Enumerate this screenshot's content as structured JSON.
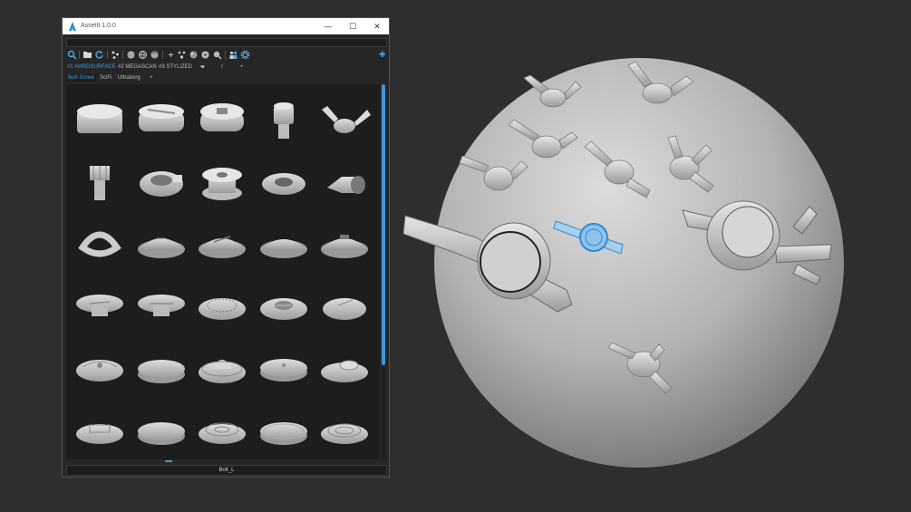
{
  "window": {
    "title": "AssetIt 1.0.0",
    "minimize_glyph": "—",
    "maximize_glyph": "☐",
    "close_glyph": "✕",
    "accent": "#3d9fe0"
  },
  "toolbar": {
    "icons": [
      "search-icon",
      "folder-icon",
      "refresh-icon",
      "scatter-icon",
      "sphere-icon",
      "globe-icon",
      "globe-alt-icon",
      "plus-small-icon",
      "scatter-alt-icon",
      "sphere-alt-icon",
      "sphere-dot-icon",
      "zoom-icon",
      "people-icon",
      "settings-icon"
    ],
    "add_glyph": "✚"
  },
  "tabs": [
    {
      "label": "#1 HARDSURFACE",
      "active": true
    },
    {
      "label": "#2 MEGASCAN",
      "active": false
    },
    {
      "label": "#3 STYLIZED",
      "active": false
    },
    {
      "label": "❤",
      "active": false
    },
    {
      "label": "/",
      "active": false
    },
    {
      "label": "+",
      "active": false
    }
  ],
  "subtabs": [
    {
      "label": "Bolt-Screw",
      "active": true
    },
    {
      "label": "SciFi",
      "active": false
    },
    {
      "label": "Ultraborg",
      "active": false
    },
    {
      "label": "+",
      "active": false
    }
  ],
  "assets": [
    "hex-cap",
    "slotted-cap",
    "square-socket-cap",
    "pin-bolt",
    "wing-nut",
    "knurled-bolt",
    "clamp-collar",
    "spool-nut",
    "ring-washer",
    "pipe-clip",
    "d-ring",
    "dome-cross",
    "dome-slot",
    "dome-plain",
    "dome-socket",
    "flange-slot",
    "flange-cross",
    "gear-plate",
    "grill-plate",
    "line-disc",
    "tech-disc",
    "flat-disc",
    "dome-hub",
    "dot-disc",
    "knob-disc",
    "tech-plate",
    "flat-plate",
    "ridge-plate",
    "plain-plate",
    "ring-plate"
  ],
  "status": {
    "selected_asset": "Bolt_L"
  },
  "scrollbar": {
    "vertical_fraction": 0.75
  }
}
